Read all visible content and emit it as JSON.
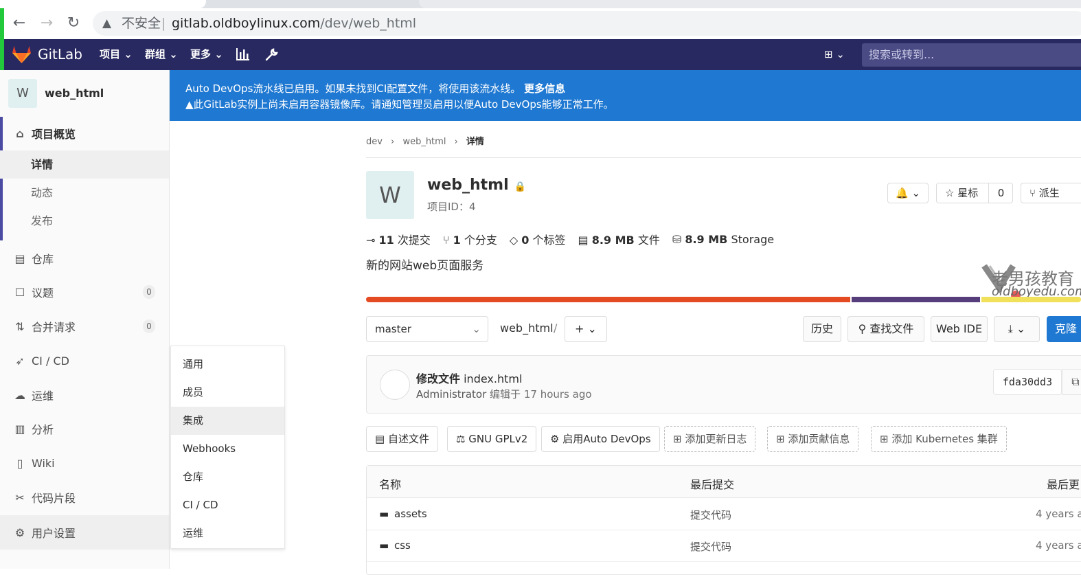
{
  "browser": {
    "insecure_label": "不安全",
    "url_host": "gitlab.oldboylinux.com",
    "url_path": "/dev/web_html"
  },
  "navbar": {
    "brand": "GitLab",
    "menu_projects": "项目",
    "menu_groups": "群组",
    "menu_more": "更多",
    "search_placeholder": "搜索或转到..."
  },
  "sidebar": {
    "project_initial": "W",
    "project_name": "web_html",
    "overview": "项目概览",
    "sub_details": "详情",
    "sub_activity": "动态",
    "sub_releases": "发布",
    "repository": "仓库",
    "issues": "议题",
    "issues_count": "0",
    "merge_requests": "合并请求",
    "mr_count": "0",
    "cicd": "CI / CD",
    "operations": "运维",
    "analytics": "分析",
    "wiki": "Wiki",
    "snippets": "代码片段",
    "settings": "用户设置"
  },
  "settings_menu": [
    "通用",
    "成员",
    "集成",
    "Webhooks",
    "仓库",
    "CI / CD",
    "运维"
  ],
  "banner": {
    "line1": "Auto DevOps流水线已启用。如果未找到CI配置文件，将使用该流水线。",
    "more_info": "更多信息",
    "line2": "此GitLab实例上尚未启用容器镜像库。请通知管理员启用以便Auto DevOps能够正常工作。"
  },
  "breadcrumb": {
    "group": "dev",
    "project": "web_html",
    "current": "详情"
  },
  "project": {
    "initial": "W",
    "title": "web_html",
    "id_label": "项目ID：4",
    "star_label": "星标",
    "star_count": "0",
    "fork_label": "派生",
    "commits_num": "11",
    "commits_label": "次提交",
    "branches_num": "1",
    "branches_label": "个分支",
    "tags_num": "0",
    "tags_label": "个标签",
    "files_size": "8.9 MB",
    "files_label": "文件",
    "storage_size": "8.9 MB",
    "storage_label": "Storage",
    "description": "新的网站web页面服务"
  },
  "watermark": {
    "cn": "老男孩教育",
    "en": "oldboyedu.com"
  },
  "languages": [
    {
      "color": "#e44b23",
      "fraction": 0.68
    },
    {
      "color": "#563d7c",
      "fraction": 0.18
    },
    {
      "color": "#f1e05a",
      "fraction": 0.14
    }
  ],
  "toolbar": {
    "branch": "master",
    "path": "web_html",
    "path_sep": "/",
    "history": "历史",
    "find_file": "查找文件",
    "web_ide": "Web IDE",
    "clone": "克隆"
  },
  "commit": {
    "title_bold": "修改文件",
    "title_rest": " index.html",
    "author": "Administrator",
    "edited": "编辑于",
    "time": "17 hours ago",
    "sha": "fda30dd3"
  },
  "quick_links": {
    "readme": "自述文件",
    "license": "GNU GPLv2",
    "autodevops": "启用Auto DevOps",
    "changelog": "添加更新日志",
    "contributing": "添加贡献信息",
    "kubernetes": "添加 Kubernetes 集群"
  },
  "file_table": {
    "headers": [
      "名称",
      "最后提交",
      "最后更"
    ],
    "rows": [
      {
        "name": "assets",
        "commit": "提交代码",
        "time": "4 years a"
      },
      {
        "name": "css",
        "commit": "提交代码",
        "time": "4 years a"
      }
    ]
  }
}
